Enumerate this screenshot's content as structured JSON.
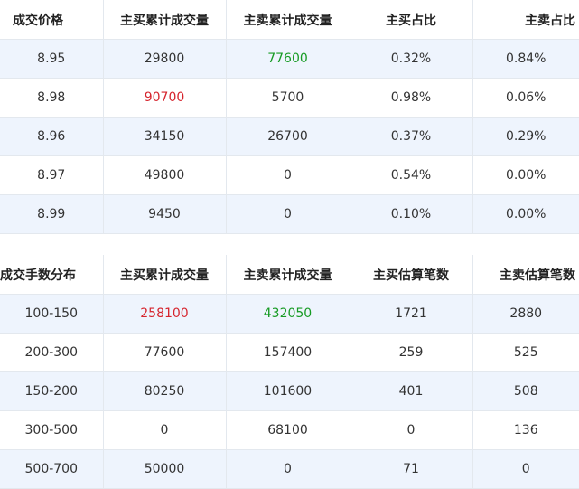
{
  "colors": {
    "red": "#d6252e",
    "green": "#179b24",
    "row_alt": "#eef4fd",
    "border": "#e3e8ee"
  },
  "price_table": {
    "headers": [
      "成交价格",
      "主买累计成交量",
      "主卖累计成交量",
      "主买占比",
      "主卖占比"
    ],
    "rows": [
      [
        "8.95",
        "29800",
        "77600",
        "0.32%",
        "0.84%"
      ],
      [
        "8.98",
        "90700",
        "5700",
        "0.98%",
        "0.06%"
      ],
      [
        "8.96",
        "34150",
        "26700",
        "0.37%",
        "0.29%"
      ],
      [
        "8.97",
        "49800",
        "0",
        "0.54%",
        "0.00%"
      ],
      [
        "8.99",
        "9450",
        "0",
        "0.10%",
        "0.00%"
      ]
    ]
  },
  "lot_table": {
    "headers": [
      "成交手数分布",
      "主买累计成交量",
      "主卖累计成交量",
      "主买估算笔数",
      "主卖估算笔数"
    ],
    "rows": [
      [
        "100-150",
        "258100",
        "432050",
        "1721",
        "2880"
      ],
      [
        "200-300",
        "77600",
        "157400",
        "259",
        "525"
      ],
      [
        "150-200",
        "80250",
        "101600",
        "401",
        "508"
      ],
      [
        "300-500",
        "0",
        "68100",
        "0",
        "136"
      ],
      [
        "500-700",
        "50000",
        "0",
        "71",
        "0"
      ]
    ]
  }
}
